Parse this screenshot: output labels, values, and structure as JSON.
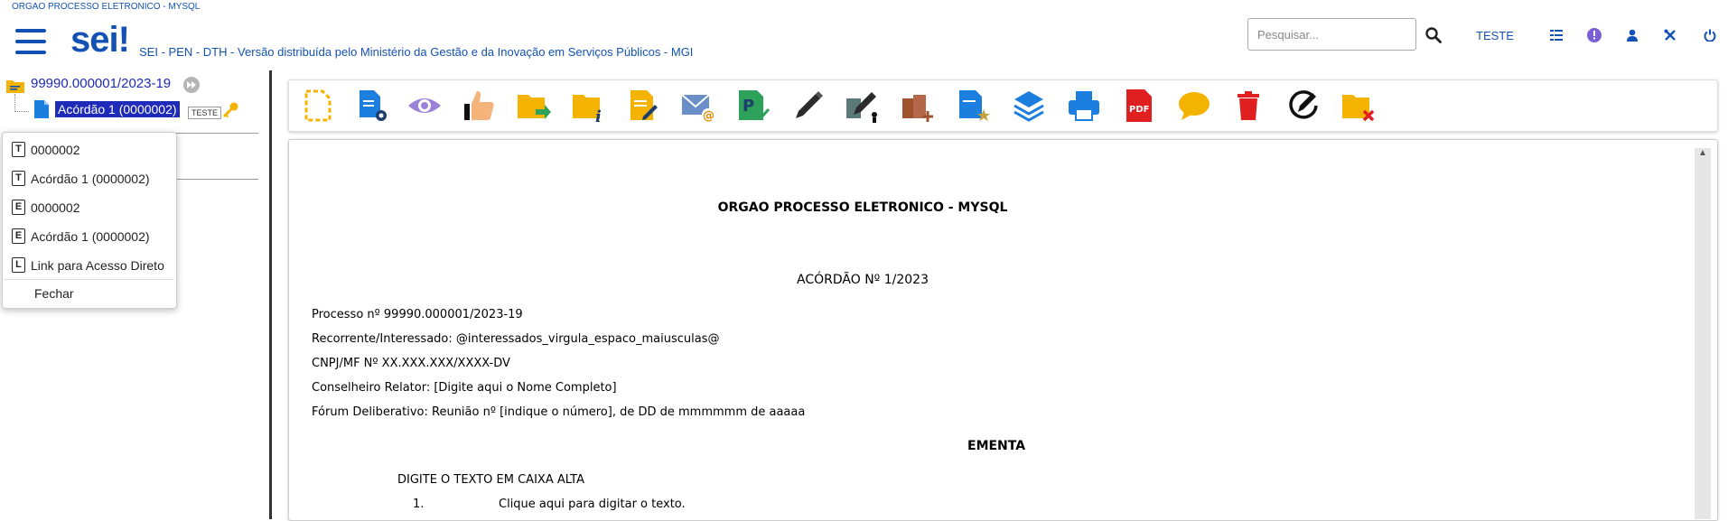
{
  "header": {
    "org_name": "ORGAO PROCESSO ELETRONICO - MYSQL",
    "logo_text": "sei!",
    "system_description": "SEI - PEN - DTH - Versão distribuída pelo Ministério da Gestão e da Inovação em Serviços Públicos - MGI",
    "search_placeholder": "Pesquisar...",
    "user_label": "TESTE",
    "icons": [
      "menu-icon",
      "search-icon",
      "grid-icon",
      "info-icon",
      "user-icon",
      "tools-icon",
      "power-icon"
    ]
  },
  "tree": {
    "process_number": "99990.000001/2023-19",
    "document_label": "Acórdão 1 (0000002)",
    "document_tag": "TESTE"
  },
  "popup": {
    "items": [
      {
        "key": "T",
        "label": "0000002"
      },
      {
        "key": "T",
        "label": "Acórdão 1 (0000002)"
      },
      {
        "key": "E",
        "label": "0000002"
      },
      {
        "key": "E",
        "label": "Acórdão 1 (0000002)"
      },
      {
        "key": "L",
        "label": "Link para Acesso Direto"
      }
    ],
    "close_label": "Fechar"
  },
  "toolbar": {
    "icons": [
      "dashed-document-icon",
      "document-settings-icon",
      "eye-icon",
      "thumbs-up-icon",
      "folder-move-icon",
      "folder-info-icon",
      "document-edit-icon",
      "email-icon",
      "signature-check-icon",
      "pen-icon",
      "pen-multiple-icon",
      "blocks-add-icon",
      "document-star-icon",
      "layers-icon",
      "printer-icon",
      "pdf-icon",
      "comment-icon",
      "trash-icon",
      "edit-circle-icon",
      "folder-remove-icon"
    ],
    "colors": {
      "yellow": "#f5b301",
      "blue": "#1c7fe0",
      "green": "#2ea15a",
      "red": "#e02020",
      "brown": "#a0522d"
    }
  },
  "document": {
    "org_title": "ORGAO PROCESSO ELETRONICO - MYSQL",
    "acordao_title": "ACÓRDÃO Nº 1/2023",
    "lines": [
      "Processo nº 99990.000001/2023-19",
      "Recorrente/Interessado: @interessados_virgula_espaco_maiusculas@",
      "CNPJ/MF Nº XX.XXX.XXX/XXXX-DV",
      "Conselheiro Relator: [Digite aqui o Nome Completo]",
      "Fórum Deliberativo: Reunião nº [indique o número], de DD de mmmmmm de aaaaa"
    ],
    "ementa_title": "EMENTA",
    "ementa_text": "DIGITE O TEXTO EM CAIXA ALTA",
    "list_number": "1.",
    "list_text": "Clique aqui para digitar o texto."
  }
}
